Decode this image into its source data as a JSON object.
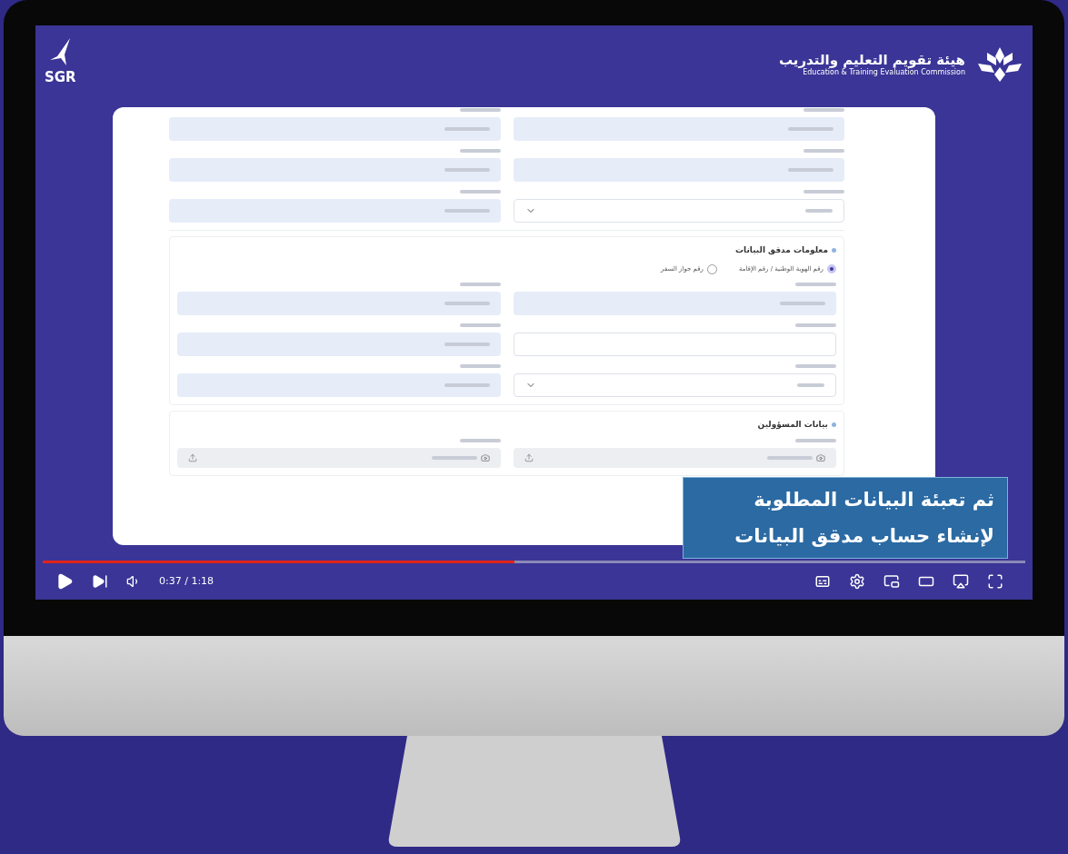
{
  "header": {
    "left_logo": "SGR",
    "org_name_ar": "هيئة تقويم التعليم والتدريب",
    "org_name_en": "Education & Training Evaluation Commission"
  },
  "form": {
    "sections": [
      {
        "rows": [
          [
            {
              "kind": "filled"
            },
            {
              "kind": "filled"
            }
          ],
          [
            {
              "kind": "filled"
            },
            {
              "kind": "filled"
            }
          ],
          [
            {
              "kind": "select"
            },
            {
              "kind": "filled"
            }
          ]
        ]
      },
      {
        "title": "معلومات مدقق البيانات",
        "radios": [
          {
            "label": "رقم الهوية الوطنية / رقم الإقامة",
            "selected": true
          },
          {
            "label": "رقم جواز السفر",
            "selected": false
          }
        ],
        "rows": [
          [
            {
              "kind": "filled"
            },
            {
              "kind": "filled"
            }
          ],
          [
            {
              "kind": "empty"
            },
            {
              "kind": "filled"
            }
          ],
          [
            {
              "kind": "select"
            },
            {
              "kind": "filled"
            }
          ]
        ]
      },
      {
        "title": "بيانات المسؤولين",
        "rows": [
          [
            {
              "kind": "upload"
            },
            {
              "kind": "upload"
            }
          ]
        ]
      }
    ]
  },
  "caption": [
    "ثم تعبئة البيانات المطلوبة",
    "لإنشاء حساب مدقق البيانات"
  ],
  "player": {
    "progress": {
      "level": 0.48
    },
    "time": "0:37 / 1:18"
  }
}
